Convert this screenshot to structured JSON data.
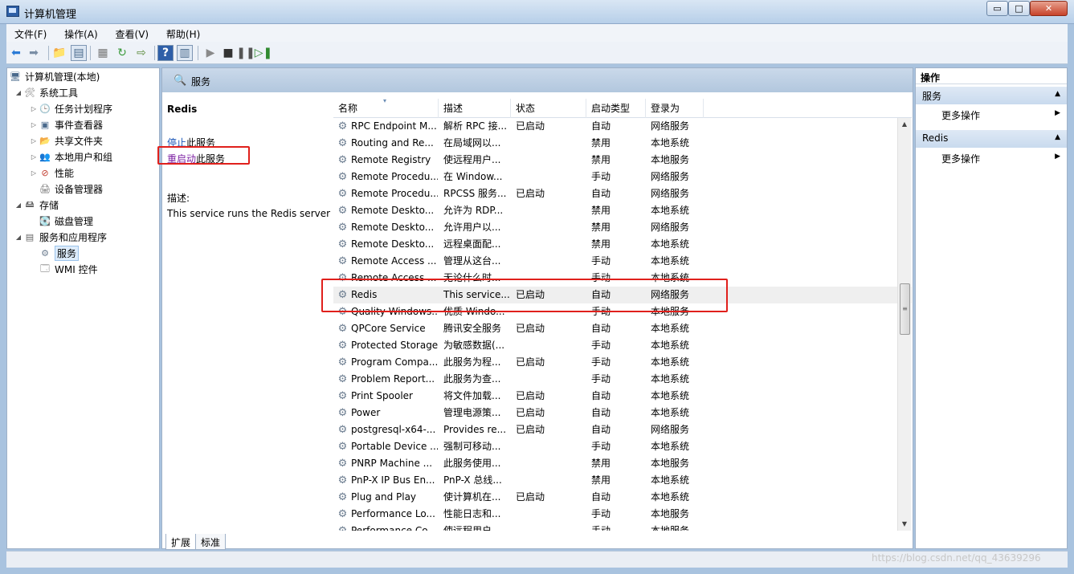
{
  "window": {
    "title": "计算机管理",
    "min_glyph": "▭",
    "max_glyph": "□",
    "close_glyph": "✕"
  },
  "menu": [
    "文件(F)",
    "操作(A)",
    "查看(V)",
    "帮助(H)"
  ],
  "tree": {
    "root": "计算机管理(本地)",
    "system_tools": "系统工具",
    "task_scheduler": "任务计划程序",
    "event_viewer": "事件查看器",
    "shared_folders": "共享文件夹",
    "local_users": "本地用户和组",
    "performance": "性能",
    "device_manager": "设备管理器",
    "storage": "存储",
    "disk_management": "磁盘管理",
    "services_apps": "服务和应用程序",
    "services": "服务",
    "wmi": "WMI 控件"
  },
  "center": {
    "header_title": "服务",
    "selected_service": "Redis",
    "stop_link": "停止",
    "stop_suffix": "此服务",
    "restart_link": "重启动",
    "restart_suffix": "此服务",
    "desc_label": "描述:",
    "desc_text": "This service runs the Redis server"
  },
  "list": {
    "columns": [
      "名称",
      "描述",
      "状态",
      "启动类型",
      "登录为"
    ],
    "rows": [
      {
        "name": "RPC Endpoint M...",
        "desc": "解析 RPC 接...",
        "status": "已启动",
        "startup": "自动",
        "logon": "网络服务"
      },
      {
        "name": "Routing and Re...",
        "desc": "在局域网以...",
        "status": "",
        "startup": "禁用",
        "logon": "本地系统"
      },
      {
        "name": "Remote Registry",
        "desc": "使远程用户...",
        "status": "",
        "startup": "禁用",
        "logon": "本地服务"
      },
      {
        "name": "Remote Procedu...",
        "desc": "在 Window...",
        "status": "",
        "startup": "手动",
        "logon": "网络服务"
      },
      {
        "name": "Remote Procedu...",
        "desc": "RPCSS 服务...",
        "status": "已启动",
        "startup": "自动",
        "logon": "网络服务"
      },
      {
        "name": "Remote Deskto...",
        "desc": "允许为 RDP...",
        "status": "",
        "startup": "禁用",
        "logon": "本地系统"
      },
      {
        "name": "Remote Deskto...",
        "desc": "允许用户以...",
        "status": "",
        "startup": "禁用",
        "logon": "网络服务"
      },
      {
        "name": "Remote Deskto...",
        "desc": "远程桌面配...",
        "status": "",
        "startup": "禁用",
        "logon": "本地系统"
      },
      {
        "name": "Remote Access ...",
        "desc": "管理从这台...",
        "status": "",
        "startup": "手动",
        "logon": "本地系统"
      },
      {
        "name": "Remote Access ...",
        "desc": "无论什么时...",
        "status": "",
        "startup": "手动",
        "logon": "本地系统"
      },
      {
        "name": "Redis",
        "desc": "This service...",
        "status": "已启动",
        "startup": "自动",
        "logon": "网络服务"
      },
      {
        "name": "Quality Windows...",
        "desc": "优质 Windo...",
        "status": "",
        "startup": "手动",
        "logon": "本地服务"
      },
      {
        "name": "QPCore Service",
        "desc": "腾讯安全服务",
        "status": "已启动",
        "startup": "自动",
        "logon": "本地系统"
      },
      {
        "name": "Protected Storage",
        "desc": "为敏感数据(...",
        "status": "",
        "startup": "手动",
        "logon": "本地系统"
      },
      {
        "name": "Program Compa...",
        "desc": "此服务为程...",
        "status": "已启动",
        "startup": "手动",
        "logon": "本地系统"
      },
      {
        "name": "Problem Report...",
        "desc": "此服务为查...",
        "status": "",
        "startup": "手动",
        "logon": "本地系统"
      },
      {
        "name": "Print Spooler",
        "desc": "将文件加载...",
        "status": "已启动",
        "startup": "自动",
        "logon": "本地系统"
      },
      {
        "name": "Power",
        "desc": "管理电源策...",
        "status": "已启动",
        "startup": "自动",
        "logon": "本地系统"
      },
      {
        "name": "postgresql-x64-...",
        "desc": "Provides re...",
        "status": "已启动",
        "startup": "自动",
        "logon": "网络服务"
      },
      {
        "name": "Portable Device ...",
        "desc": "强制可移动...",
        "status": "",
        "startup": "手动",
        "logon": "本地系统"
      },
      {
        "name": "PNRP Machine ...",
        "desc": "此服务使用...",
        "status": "",
        "startup": "禁用",
        "logon": "本地服务"
      },
      {
        "name": "PnP-X IP Bus En...",
        "desc": "PnP-X 总线...",
        "status": "",
        "startup": "禁用",
        "logon": "本地系统"
      },
      {
        "name": "Plug and Play",
        "desc": "使计算机在...",
        "status": "已启动",
        "startup": "自动",
        "logon": "本地系统"
      },
      {
        "name": "Performance Lo...",
        "desc": "性能日志和...",
        "status": "",
        "startup": "手动",
        "logon": "本地服务"
      },
      {
        "name": "Performance Co...",
        "desc": "使远程用户...",
        "status": "",
        "startup": "手动",
        "logon": "本地服务"
      }
    ]
  },
  "tabs": [
    "扩展",
    "标准"
  ],
  "actions": {
    "title": "操作",
    "section1": "服务",
    "section1_item": "更多操作",
    "section2": "Redis",
    "section2_item": "更多操作"
  },
  "watermark": "https://blog.csdn.net/qq_43639296",
  "colors": {
    "highlight_box": "#e0201c",
    "link": "#1a56b8",
    "visited_link": "#7b1fa2"
  }
}
